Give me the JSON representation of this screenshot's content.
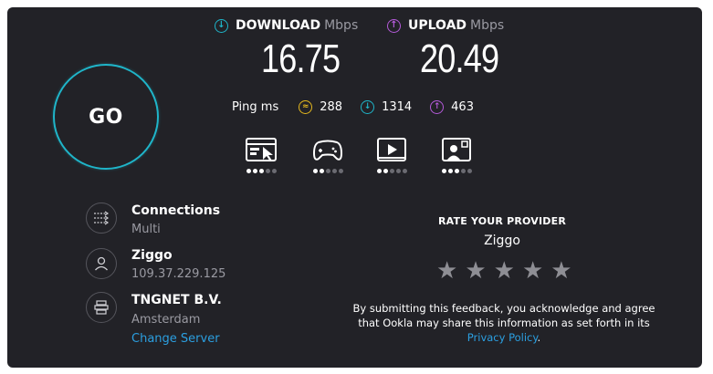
{
  "go_button": {
    "label": "GO"
  },
  "download": {
    "label": "DOWNLOAD",
    "unit": "Mbps",
    "value": "16.75",
    "color": "#1fb5c9"
  },
  "upload": {
    "label": "UPLOAD",
    "unit": "Mbps",
    "value": "20.49",
    "color": "#b45ad9"
  },
  "ping": {
    "label": "Ping ms",
    "idle": {
      "value": "288",
      "color": "#e5b81e"
    },
    "download": {
      "value": "1314",
      "color": "#1fb5c9"
    },
    "upload": {
      "value": "463",
      "color": "#b45ad9"
    }
  },
  "activities": [
    {
      "name": "web-browsing",
      "rating": 3,
      "max": 5
    },
    {
      "name": "gaming",
      "rating": 2,
      "max": 5
    },
    {
      "name": "video-streaming",
      "rating": 2,
      "max": 5
    },
    {
      "name": "video-chat",
      "rating": 3,
      "max": 5
    }
  ],
  "connections": {
    "title": "Connections",
    "value": "Multi"
  },
  "provider": {
    "name": "Ziggo",
    "ip": "109.37.229.125"
  },
  "server": {
    "name": "TNGNET B.V.",
    "location": "Amsterdam",
    "change_link": "Change Server"
  },
  "rate": {
    "title": "RATE YOUR PROVIDER",
    "provider": "Ziggo",
    "stars": 5,
    "disclaimer": "By submitting this feedback, you acknowledge and agree that Ookla may share this information as set forth in its",
    "policy_link": "Privacy Policy",
    "period": "."
  }
}
